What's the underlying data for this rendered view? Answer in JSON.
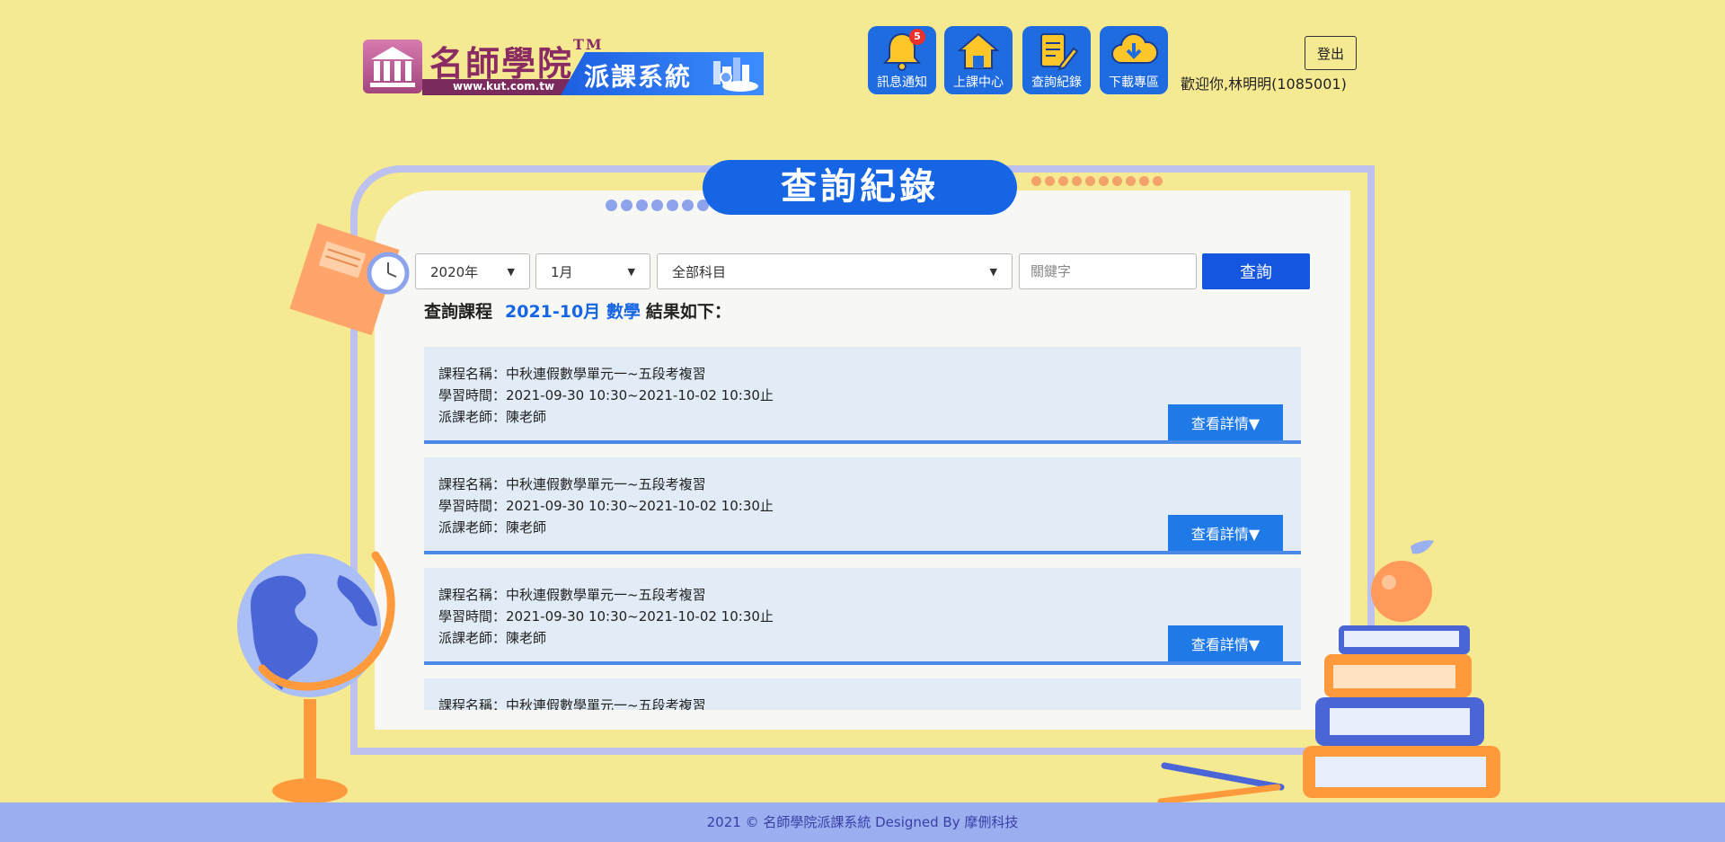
{
  "header": {
    "logo_brand": "名師學院",
    "logo_tm": "TM",
    "logo_url": "www.kut.com.tw",
    "logo_system": "派課系統",
    "nav": [
      {
        "label": "訊息通知",
        "icon": "bell-icon",
        "badge": "5"
      },
      {
        "label": "上課中心",
        "icon": "house-icon"
      },
      {
        "label": "查詢紀錄",
        "icon": "document-pencil-icon"
      },
      {
        "label": "下載專區",
        "icon": "cloud-download-icon"
      }
    ],
    "logout_label": "登出",
    "welcome_text": "歡迎你,林明明(1085001)"
  },
  "page": {
    "title": "查詢紀錄"
  },
  "filters": {
    "year": "2020年",
    "month": "1月",
    "subject": "全部科目",
    "keyword_placeholder": "關鍵字",
    "search_label": "查詢"
  },
  "summary": {
    "prefix": "查詢課程",
    "highlight": "2021-10月 數學",
    "suffix": "結果如下："
  },
  "results": [
    {
      "name": "課程名稱：中秋連假數學單元一~五段考複習",
      "time": "學習時間：2021-09-30 10:30~2021-10-02 10:30止",
      "teacher": "派課老師：陳老師",
      "detail_label": "查看詳情▼"
    },
    {
      "name": "課程名稱：中秋連假數學單元一~五段考複習",
      "time": "學習時間：2021-09-30 10:30~2021-10-02 10:30止",
      "teacher": "派課老師：陳老師",
      "detail_label": "查看詳情▼"
    },
    {
      "name": "課程名稱：中秋連假數學單元一~五段考複習",
      "time": "學習時間：2021-09-30 10:30~2021-10-02 10:30止",
      "teacher": "派課老師：陳老師",
      "detail_label": "查看詳情▼"
    },
    {
      "name": "課程名稱：中秋連假數學單元一~五段考複習",
      "time": "",
      "teacher": "",
      "detail_label": ""
    }
  ],
  "footer": {
    "text": "2021 © 名師學院派課系統 Designed By 摩侀科技"
  },
  "colors": {
    "background": "#f5e991",
    "primary_blue": "#1565e4",
    "card_bg": "#e1ecf6",
    "footer_bg": "#9aaef0"
  }
}
